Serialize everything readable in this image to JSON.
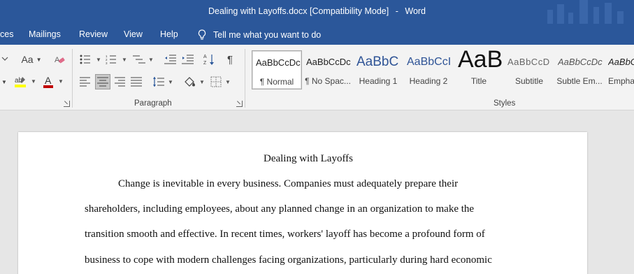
{
  "window": {
    "doc_name": "Dealing with Layoffs.docx",
    "mode": "[Compatibility Mode]",
    "separator": "-",
    "app": "Word"
  },
  "tabs": {
    "references_partial": "ces",
    "mailings": "Mailings",
    "review": "Review",
    "view": "View",
    "help": "Help",
    "tell_me": "Tell me what you want to do"
  },
  "ribbon": {
    "paragraph_label": "Paragraph",
    "styles_label": "Styles",
    "font_case_label": "Aa",
    "highlight_color": "#ffff00",
    "font_color": "#c00000",
    "styles": [
      {
        "preview": "AaBbCcDc",
        "name": "¶ Normal"
      },
      {
        "preview": "AaBbCcDc",
        "name": "¶ No Spac..."
      },
      {
        "preview": "AaBbC",
        "name": "Heading 1"
      },
      {
        "preview": "AaBbCcI",
        "name": "Heading 2"
      },
      {
        "preview": "AaB",
        "name": "Title"
      },
      {
        "preview": "AaBbCcD",
        "name": "Subtitle"
      },
      {
        "preview": "AaBbCcDc",
        "name": "Subtle Em..."
      },
      {
        "preview": "AaBbCcDc",
        "name": "Emphasis"
      }
    ]
  },
  "document": {
    "title": "Dealing with Layoffs",
    "lines": [
      "Change is inevitable in every business. Companies must adequately prepare their",
      "shareholders, including employees, about any planned change in an organization to make the",
      "transition smooth and effective. In recent times, workers' layoff has become a profound form of",
      "business to cope with modern challenges facing organizations, particularly during hard economic"
    ]
  }
}
